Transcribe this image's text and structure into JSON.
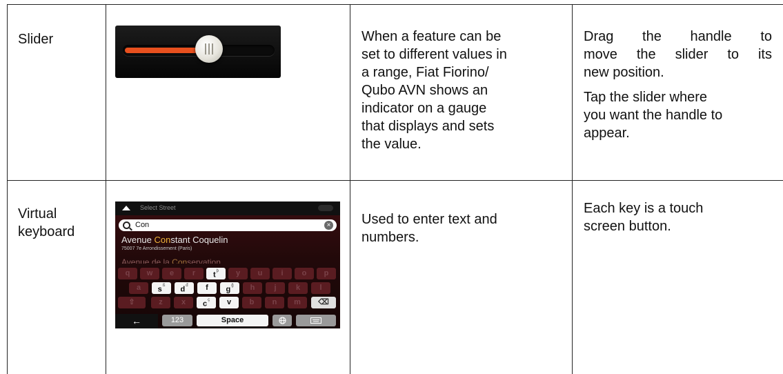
{
  "rows": [
    {
      "label": "Slider",
      "description": [
        "When a feature can be",
        "set to different values in",
        "a range, Fiat Fiorino/",
        "Qubo AVN shows an",
        "indicator on a gauge",
        "that displays and sets",
        "the value."
      ],
      "usage": [
        "Drag the handle to",
        "move the slider to its",
        "new position.",
        "Tap the slider where",
        "you want the handle to",
        "appear."
      ],
      "slider": {
        "value_fraction": 0.57,
        "fill_color": "#e8501e"
      }
    },
    {
      "label": [
        "Virtual",
        "keyboard"
      ],
      "description": [
        "Used to enter text and",
        "numbers."
      ],
      "usage": [
        "Each key is a touch",
        "screen button."
      ]
    }
  ],
  "keyboard": {
    "header_title": "Select Street",
    "search_value": "Con",
    "results": [
      {
        "before": "Avenue ",
        "match": "Con",
        "after": "stant Coquelin",
        "sub": "75007 7e Arrondissement (Paris)"
      },
      {
        "before": "Avenue de la ",
        "match": "Con",
        "after": "servation"
      }
    ],
    "row1": [
      "q",
      "w",
      "e",
      "r",
      "t",
      "y",
      "u",
      "i",
      "o",
      "p"
    ],
    "row2": [
      "a",
      "s",
      "d",
      "f",
      "g",
      "h",
      "j",
      "k",
      "l"
    ],
    "row3": [
      "z",
      "x",
      "c",
      "v",
      "b",
      "n",
      "m"
    ],
    "enabled_keys": [
      "t",
      "s",
      "d",
      "f",
      "g",
      "c",
      "v"
    ],
    "superscripts": {
      "t": "þ",
      "s": "ß",
      "d": "đ",
      "g": "ğ",
      "c": "ç"
    },
    "bottom": {
      "back": "←",
      "numbers": "123",
      "space": "Space",
      "globe": "globe-icon",
      "hide": "keyboard-icon"
    },
    "colors": {
      "accent": "#f0b43a",
      "key_off": "#5a1c21",
      "key_on": "#f4f4f4"
    }
  }
}
